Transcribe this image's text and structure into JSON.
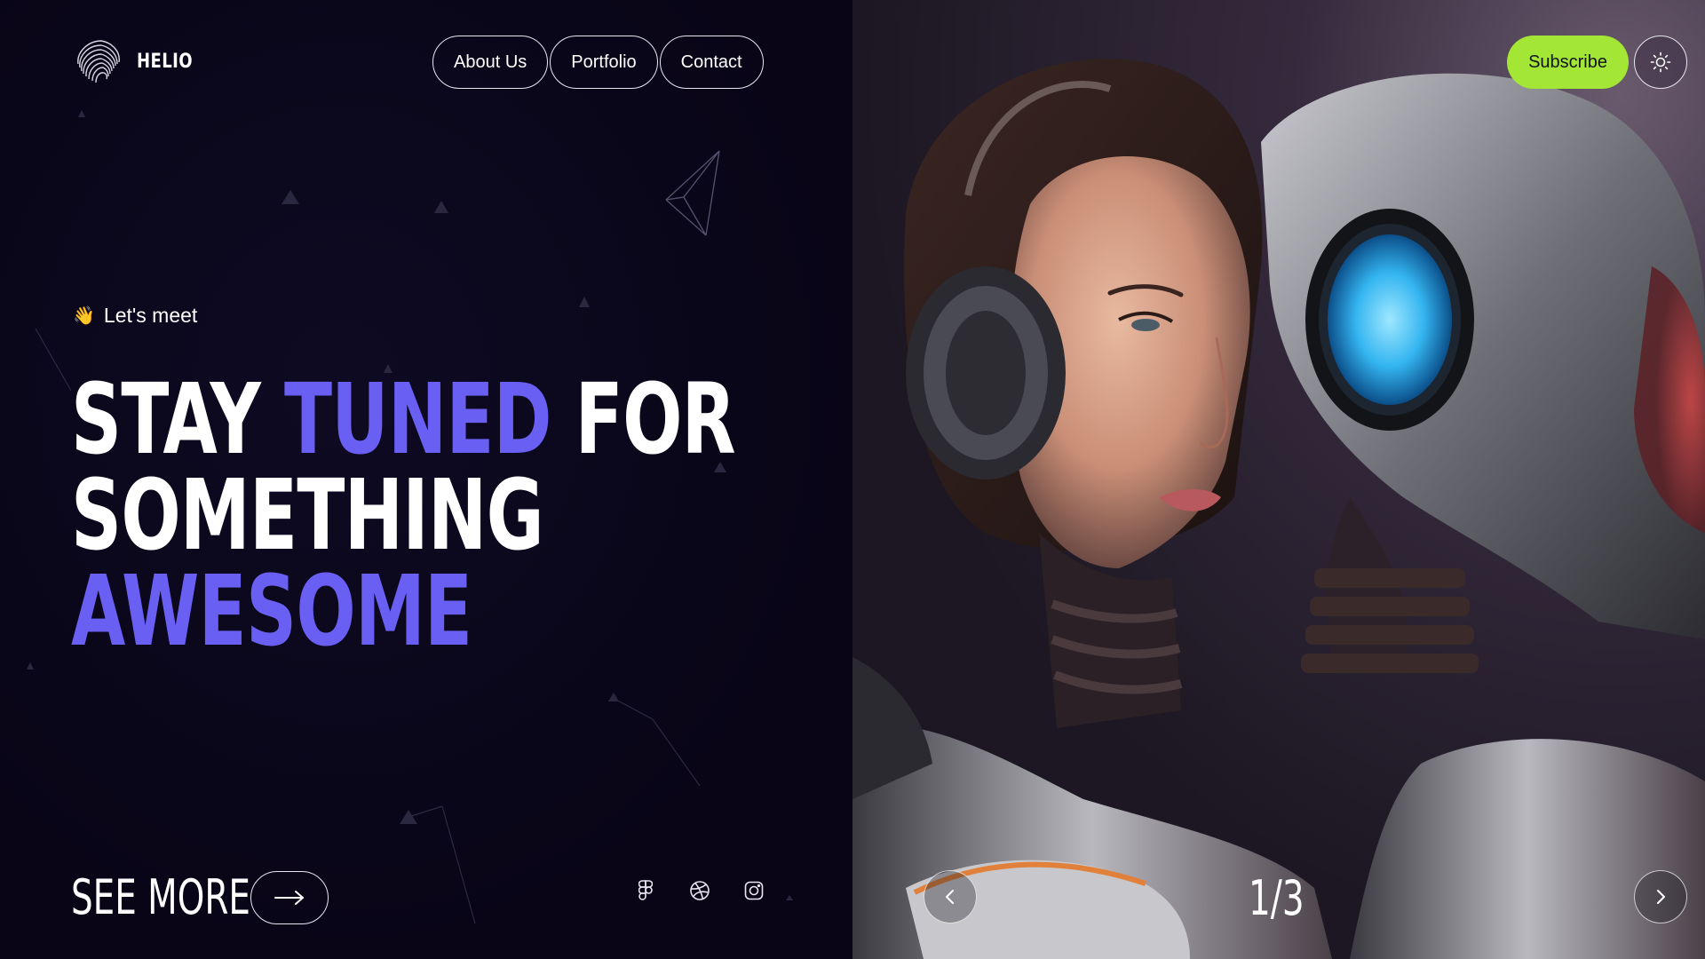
{
  "brand": {
    "name": "HELIO"
  },
  "nav": {
    "items": [
      {
        "label": "About Us"
      },
      {
        "label": "Portfolio"
      },
      {
        "label": "Contact"
      }
    ]
  },
  "hero": {
    "eyebrow_emoji": "👋",
    "eyebrow": "Let's meet",
    "headline": {
      "line1_part1": "STAY ",
      "line1_accent": "TUNED",
      "line1_part2": " FOR",
      "line2": "SOMETHING",
      "line3_accent": "AWESOME"
    }
  },
  "cta": {
    "see_more_label": "SEE MORE",
    "arrow_icon": "arrow-right-icon"
  },
  "socials": [
    {
      "icon": "figma-icon"
    },
    {
      "icon": "dribbble-icon"
    },
    {
      "icon": "instagram-icon"
    }
  ],
  "header_right": {
    "subscribe_label": "Subscribe",
    "theme_icon": "sun-icon"
  },
  "slider": {
    "counter": "1/3",
    "current": 1,
    "total": 3
  },
  "colors": {
    "background": "#0a0619",
    "accent": "#6a5ff3",
    "subscribe": "#a3e635",
    "text": "#ffffff"
  }
}
